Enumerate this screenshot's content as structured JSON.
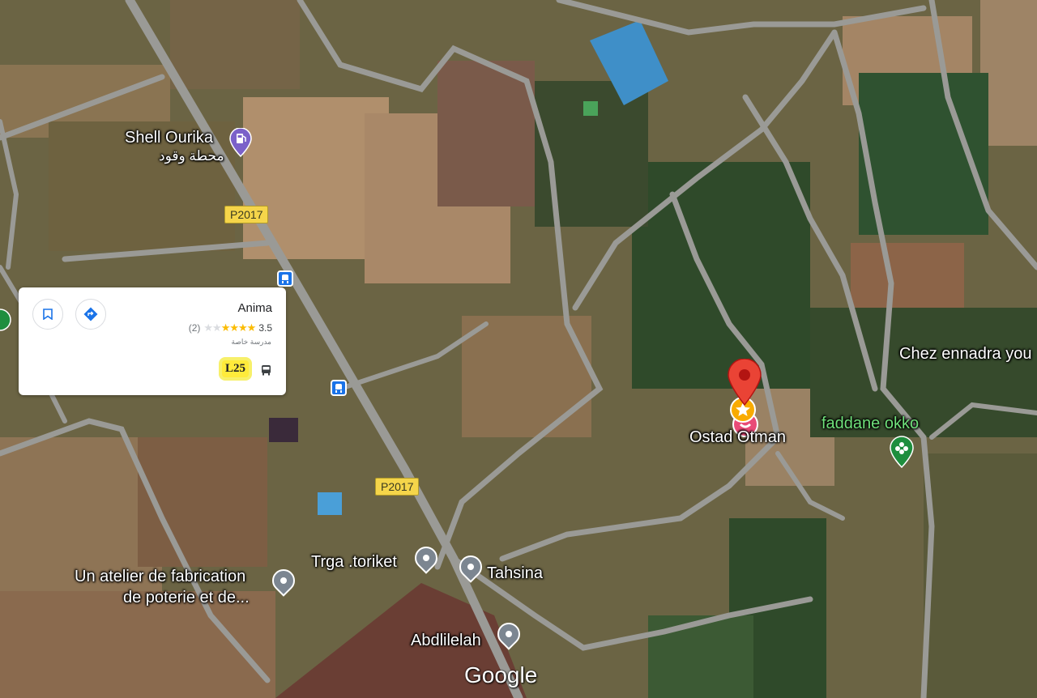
{
  "map": {
    "places": [
      {
        "name": "Shell Ourika",
        "subname": "محطة وقود",
        "icon": "gas-station-icon"
      },
      {
        "name": "Chez ennadra you"
      },
      {
        "name": "faddane okko",
        "icon": "garden-icon"
      },
      {
        "name": "Ostad Otman"
      },
      {
        "name": "Trga .toriket"
      },
      {
        "name": "Tahsina"
      },
      {
        "name": "Un atelier de fabrication",
        "name2": "de poterie et de..."
      },
      {
        "name": "Abdlilelah"
      }
    ],
    "road_shields": [
      "P2017",
      "P2017"
    ],
    "attribution": "Google",
    "colors": {
      "selected_pin": "#ea4335",
      "green_label": "#6fe07a",
      "bus_stop": "#1a73e8",
      "route_badge": "#ffeb3b"
    }
  },
  "card": {
    "title": "Anima",
    "review_count": "(2)",
    "rating": "3.5",
    "stars": "★★★★",
    "stars_off": "★",
    "category": "مدرسة خاصة",
    "route": "L25",
    "save_icon": "bookmark-icon",
    "directions_icon": "directions-icon",
    "transit_icon": "bus-icon"
  }
}
